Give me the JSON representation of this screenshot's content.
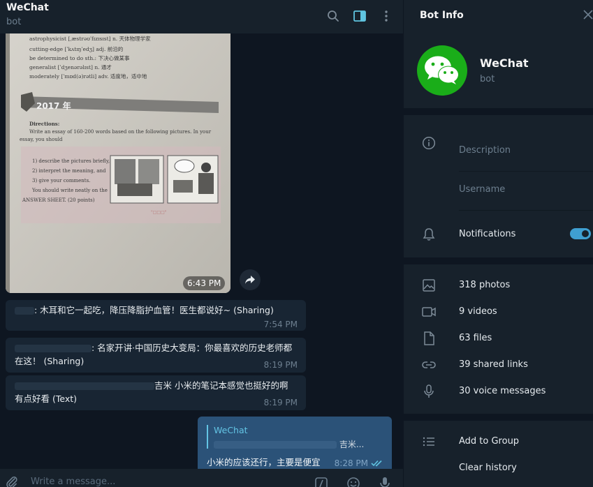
{
  "chat": {
    "title": "WeChat",
    "subtitle": "bot",
    "photo_time": "6:43 PM",
    "photo_text": {
      "line1": "astrophysicist [ˌæstrəʊˈfɪzɪsɪst] n. 天体物理学家",
      "line2": "cutting-edge [ˈkʌtɪŋˈedʒ] adj. 前沿的",
      "line3": "be determined to do sth.: 下决心做某事",
      "line4": "generalist [ˈdʒenərəlɪst] n. 通才",
      "line5": "moderately [ˈmɒd(ə)rətli] adv. 适度地，适中地",
      "year": "2017 年",
      "directions": "Directions:",
      "dir_text": "Write an essay of 160-200 words based on the following pictures. In your essay, you should",
      "item1": "1) describe the pictures briefly,",
      "item2": "2) interpret the meaning, and",
      "item3": "3) give your comments.",
      "note1": "You should write neatly on the",
      "note2": "ANSWER SHEET. (20 points)"
    },
    "messages": [
      {
        "text": ": 木耳和它一起吃，降压降脂护血管！医生都说好~ (Sharing)",
        "time": "7:54 PM"
      },
      {
        "text1": ": 名家开讲·中国历史大变局：你最喜欢的历史老师都",
        "text2": "在这！ (Sharing)",
        "time": "8:19 PM"
      },
      {
        "text1": "吉米 小米的笔记本感觉也挺好的啊",
        "text2": "有点好看 (Text)",
        "time": "8:19 PM"
      }
    ],
    "outgoing": {
      "reply_name": "WeChat",
      "reply_text": "吉米...",
      "text": "小米的应该还行，主要是便宜",
      "time": "8:28 PM"
    },
    "composer_placeholder": "Write a message..."
  },
  "info": {
    "title": "Bot Info",
    "name": "WeChat",
    "subtitle": "bot",
    "description_label": "Description",
    "username_label": "Username",
    "notifications_label": "Notifications",
    "notifications_on": true,
    "media": [
      {
        "icon": "photo-icon",
        "label": "318 photos"
      },
      {
        "icon": "video-icon",
        "label": "9 videos"
      },
      {
        "icon": "file-icon",
        "label": "63 files"
      },
      {
        "icon": "link-icon",
        "label": "39 shared links"
      },
      {
        "icon": "microphone-icon",
        "label": "30 voice messages"
      }
    ],
    "add_to_group": "Add to Group",
    "clear_history": "Clear history"
  },
  "colors": {
    "accent": "#3f9fd1",
    "wechat_green": "#1aad19",
    "outgoing_bubble": "#2b5278",
    "incoming_bubble": "#182533"
  }
}
